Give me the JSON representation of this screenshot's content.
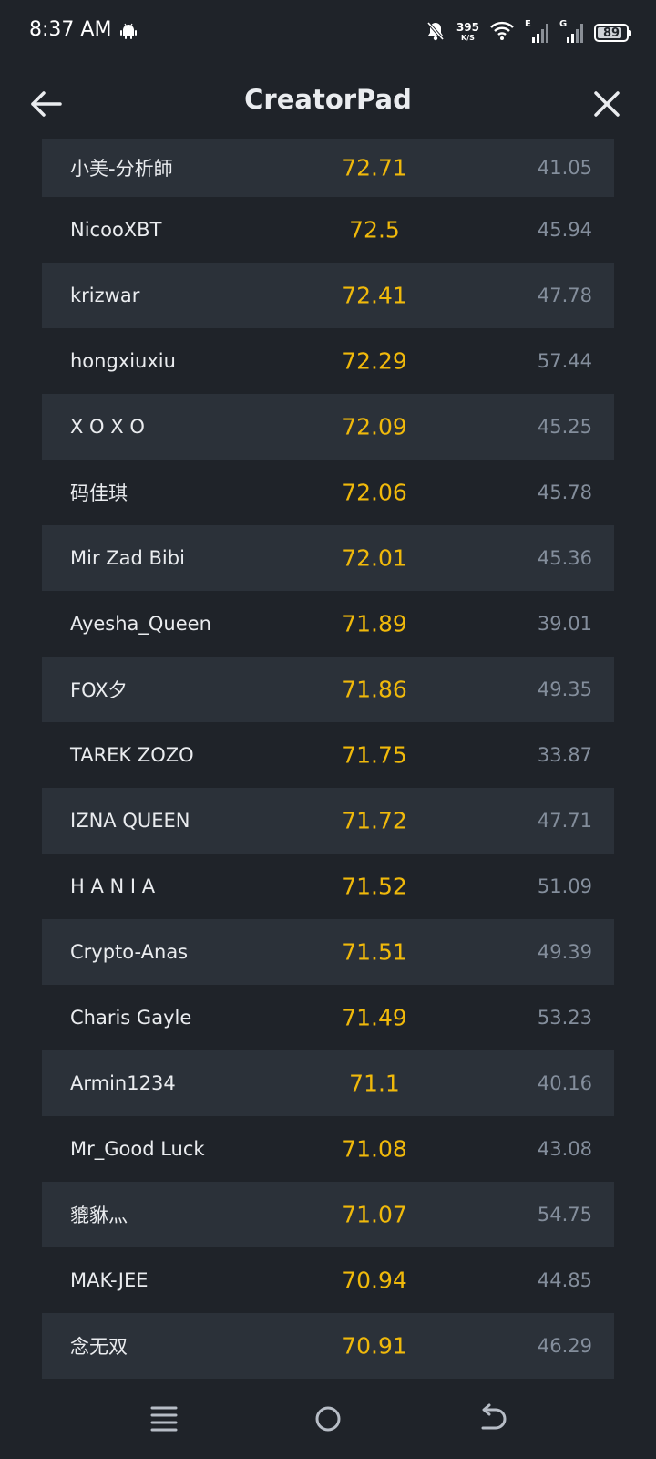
{
  "status_bar": {
    "time": "8:37 AM",
    "net_speed": "395",
    "net_speed_unit": "K/S",
    "signal1_label": "E",
    "signal2_label": "G",
    "battery_level": "89",
    "battery_percent": 89,
    "icons": [
      "android-icon",
      "notifications-off-icon",
      "wifi-icon",
      "signal-icon",
      "battery-icon"
    ]
  },
  "header": {
    "title": "CreatorPad",
    "back_icon": "arrow-left-icon",
    "close_icon": "close-icon"
  },
  "leaderboard": {
    "rows": [
      {
        "name": "小美-分析師",
        "score": "72.71",
        "secondary": "41.05"
      },
      {
        "name": "NicooXBT",
        "score": "72.5",
        "secondary": "45.94"
      },
      {
        "name": "krizwar",
        "score": "72.41",
        "secondary": "47.78"
      },
      {
        "name": "hongxiuxiu",
        "score": "72.29",
        "secondary": "57.44"
      },
      {
        "name": "X O X O",
        "score": "72.09",
        "secondary": "45.25"
      },
      {
        "name": "码佳琪",
        "score": "72.06",
        "secondary": "45.78"
      },
      {
        "name": "Mir Zad Bibi",
        "score": "72.01",
        "secondary": "45.36"
      },
      {
        "name": "Ayesha_Queen",
        "score": "71.89",
        "secondary": "39.01"
      },
      {
        "name": "FOX夕",
        "score": "71.86",
        "secondary": "49.35"
      },
      {
        "name": "TAREK ZOZO",
        "score": "71.75",
        "secondary": "33.87"
      },
      {
        "name": "IZNA QUEEN",
        "score": "71.72",
        "secondary": "47.71"
      },
      {
        "name": "H A N I A",
        "score": "71.52",
        "secondary": "51.09"
      },
      {
        "name": "Crypto-Anas",
        "score": "71.51",
        "secondary": "49.39"
      },
      {
        "name": "Charis Gayle",
        "score": "71.49",
        "secondary": "53.23"
      },
      {
        "name": "Armin1234",
        "score": "71.1",
        "secondary": "40.16"
      },
      {
        "name": "Mr_Good Luck",
        "score": "71.08",
        "secondary": "43.08"
      },
      {
        "name": "貔貅灬",
        "score": "71.07",
        "secondary": "54.75"
      },
      {
        "name": "MAK-JEE",
        "score": "70.94",
        "secondary": "44.85"
      },
      {
        "name": "念无双",
        "score": "70.91",
        "secondary": "46.29"
      }
    ]
  },
  "nav_bar": {
    "icons": [
      "menu-icon",
      "home-icon",
      "back-icon"
    ]
  },
  "colors": {
    "background": "#1f2329",
    "row_shaded": "#2b3139",
    "score": "#f0b90b",
    "secondary": "#848e9c",
    "text": "#eaecef"
  }
}
